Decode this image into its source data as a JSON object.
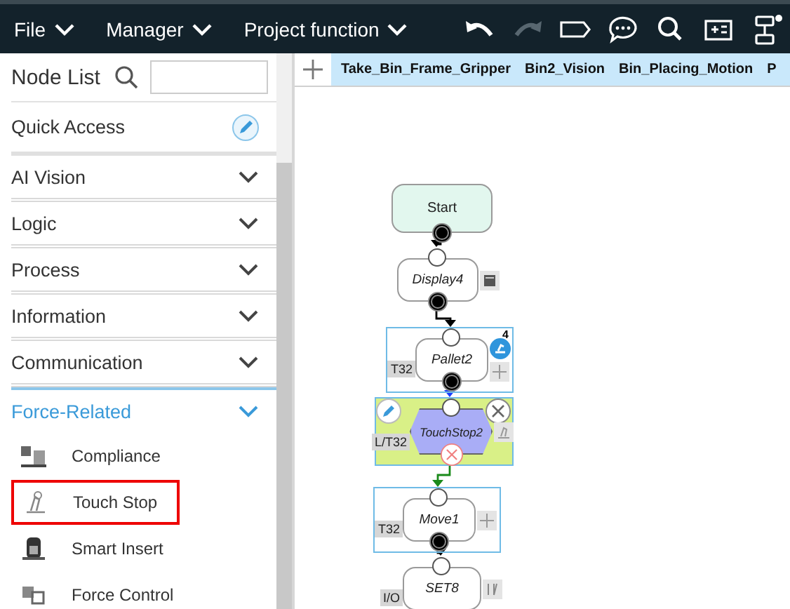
{
  "menu": [
    {
      "label": "File"
    },
    {
      "label": "Manager"
    },
    {
      "label": "Project function"
    }
  ],
  "toolbar": [
    {
      "kind": "undo",
      "disabled": false
    },
    {
      "kind": "redo",
      "disabled": true
    },
    {
      "kind": "tag",
      "disabled": false
    },
    {
      "kind": "chat",
      "disabled": false
    },
    {
      "kind": "search",
      "disabled": false
    },
    {
      "kind": "panel",
      "disabled": false
    },
    {
      "kind": "flow",
      "disabled": false
    }
  ],
  "sidebar": {
    "title": "Node List",
    "quick_access": "Quick Access",
    "categories": [
      {
        "label": "AI Vision",
        "expanded": false
      },
      {
        "label": "Logic",
        "expanded": false
      },
      {
        "label": "Process",
        "expanded": false
      },
      {
        "label": "Information",
        "expanded": false
      },
      {
        "label": "Communication",
        "expanded": false
      },
      {
        "label": "Force-Related",
        "expanded": true,
        "children": [
          {
            "label": "Compliance",
            "kind": "compliance",
            "selected": false
          },
          {
            "label": "Touch Stop",
            "kind": "touch",
            "selected": true
          },
          {
            "label": "Smart Insert",
            "kind": "insert",
            "selected": false
          },
          {
            "label": "Force Control",
            "kind": "force",
            "selected": false
          }
        ]
      }
    ]
  },
  "tabs": [
    "Take_Bin_Frame_Gripper",
    "Bin2_Vision",
    "Bin_Placing_Motion",
    "P"
  ],
  "flow": [
    {
      "kind": "start",
      "label": "Start",
      "framed": false,
      "selected": false
    },
    {
      "kind": "action",
      "label": "Display4",
      "framed": false,
      "selected": false
    },
    {
      "kind": "action",
      "label": "Pallet2",
      "tag": "T32",
      "badge": "4",
      "framed": true,
      "selected": false
    },
    {
      "kind": "condition",
      "label": "TouchStop2",
      "tag": "L/T32",
      "framed": true,
      "selected": true
    },
    {
      "kind": "action",
      "label": "Move1",
      "tag": "T32",
      "framed": true,
      "selected": false
    },
    {
      "kind": "action",
      "label": "SET8",
      "tag": "I/O",
      "framed": false,
      "selected": false
    }
  ]
}
